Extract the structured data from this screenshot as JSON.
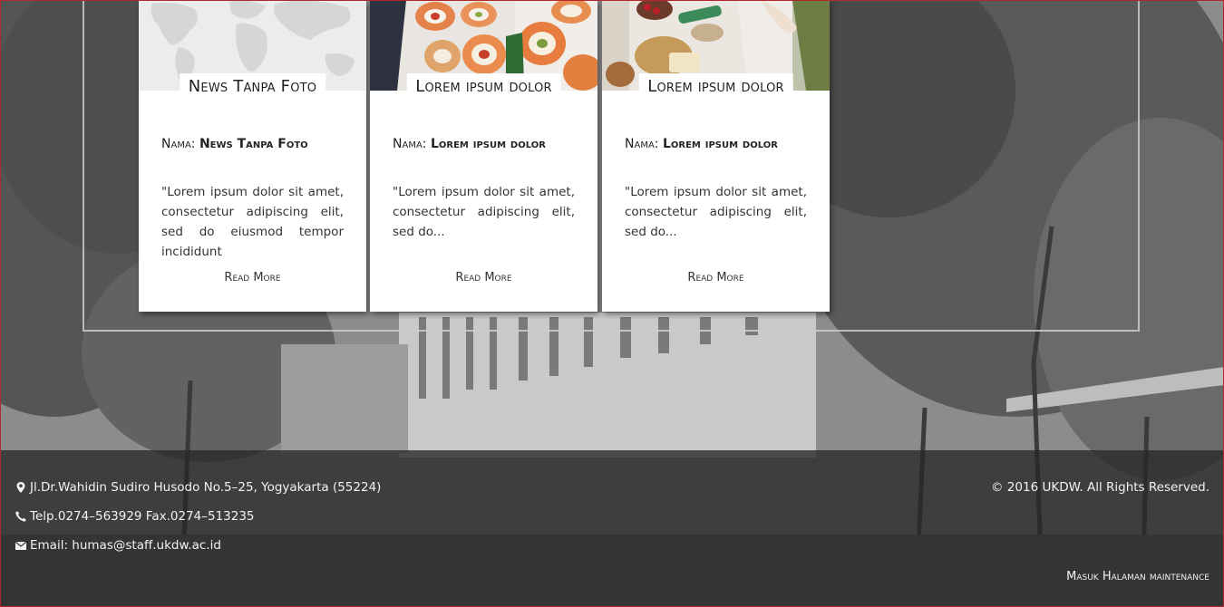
{
  "news": {
    "cards": [
      {
        "title": "News Tanpa Foto",
        "meta_label": "Nama: ",
        "meta_value": "News Tanpa Foto",
        "excerpt": "\"Lorem ipsum dolor sit amet, consectetur adipiscing elit, sed do eiusmod tempor incididunt",
        "read_more": "Read More",
        "thumb_icon": "world-map-icon"
      },
      {
        "title": "Lorem ipsum dolor",
        "meta_label": "Nama: ",
        "meta_value": "Lorem ipsum dolor",
        "excerpt": "\"Lorem ipsum dolor sit amet, consectetur adipiscing elit, sed do...",
        "read_more": "Read More",
        "thumb_icon": "sushi-photo"
      },
      {
        "title": "Lorem ipsum dolor",
        "meta_label": "Nama: ",
        "meta_value": "Lorem ipsum dolor",
        "excerpt": "\"Lorem ipsum dolor sit amet, consectetur adipiscing elit, sed do...",
        "read_more": "Read More",
        "thumb_icon": "picnic-photo"
      }
    ]
  },
  "footer": {
    "address": "Jl.Dr.Wahidin Sudiro Husodo No.5–25, Yogyakarta (55224)",
    "phone": "Telp.0274–563929 Fax.0274–513235",
    "email": "Email: humas@staff.ukdw.ac.id",
    "copyright": "© 2016 UKDW. All Rights Reserved.",
    "maintenance_link": "Masuk Halaman maintenance",
    "icons": [
      "map-marker-icon",
      "phone-icon",
      "envelope-icon"
    ]
  },
  "colors": {
    "page_border": "#b3262b",
    "footer_bg": "#282828",
    "card_bg": "#ffffff"
  }
}
